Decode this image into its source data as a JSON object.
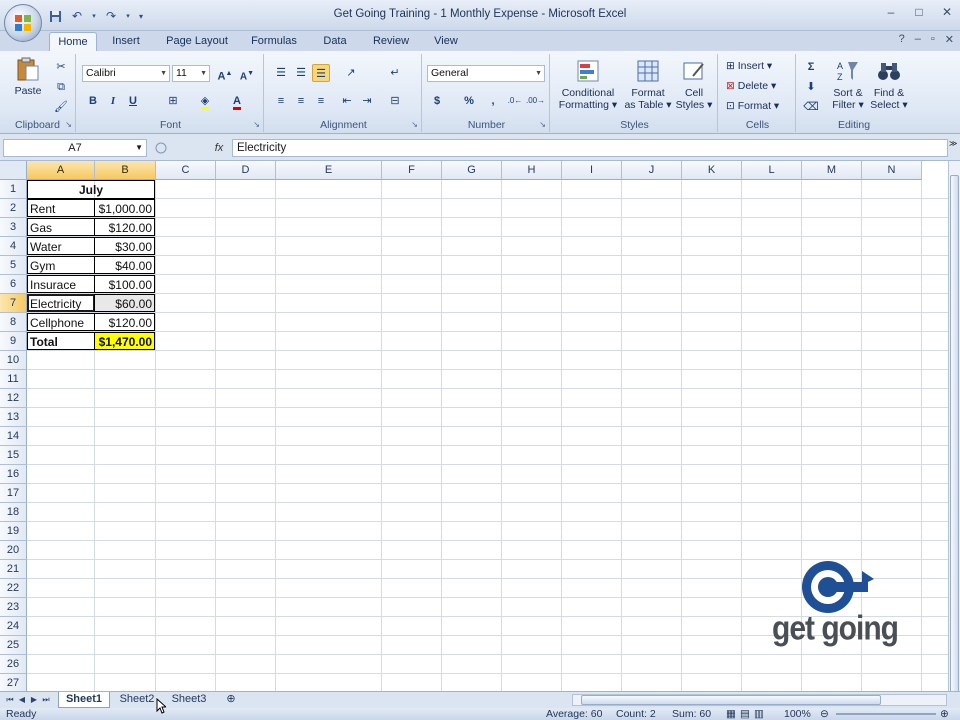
{
  "window": {
    "title": "Get Going Training - 1 Monthly Expense - Microsoft Excel",
    "controls": [
      "–",
      "□",
      "✕"
    ]
  },
  "qat": {
    "icons": [
      "save-icon",
      "undo-icon",
      "redo-icon",
      "customize-icon"
    ]
  },
  "tabs": [
    "Home",
    "Insert",
    "Page Layout",
    "Formulas",
    "Data",
    "Review",
    "View"
  ],
  "active_tab": "Home",
  "ribbon": {
    "clipboard": {
      "label": "Clipboard",
      "paste": "Paste"
    },
    "font": {
      "label": "Font",
      "name": "Calibri",
      "size": "11",
      "bold": "B",
      "italic": "I",
      "underline": "U"
    },
    "alignment": {
      "label": "Alignment"
    },
    "number": {
      "label": "Number",
      "format": "General",
      "currency": "$",
      "percent": "%",
      "comma": ","
    },
    "styles": {
      "label": "Styles",
      "conditional_1": "Conditional",
      "conditional_2": "Formatting",
      "format_table_1": "Format",
      "format_table_2": "as Table",
      "cell_styles_1": "Cell",
      "cell_styles_2": "Styles"
    },
    "cells": {
      "label": "Cells",
      "insert": "Insert",
      "delete": "Delete",
      "format": "Format"
    },
    "editing": {
      "label": "Editing",
      "sort_1": "Sort &",
      "sort_2": "Filter",
      "find_1": "Find &",
      "find_2": "Select"
    }
  },
  "formula_bar": {
    "name_box": "A7",
    "fx": "fx",
    "content": "Electricity"
  },
  "columns": [
    "A",
    "B",
    "C",
    "D",
    "E",
    "F",
    "G",
    "H",
    "I",
    "J",
    "K",
    "L",
    "M",
    "N"
  ],
  "rows": [
    "1",
    "2",
    "3",
    "4",
    "5",
    "6",
    "7",
    "8",
    "9",
    "10",
    "11",
    "12",
    "13",
    "14",
    "15",
    "16",
    "17",
    "18",
    "19",
    "20",
    "21",
    "22",
    "23",
    "24",
    "25",
    "26",
    "27"
  ],
  "sheet": {
    "header": "July",
    "items": [
      {
        "label": "Rent",
        "value": "$1,000.00"
      },
      {
        "label": "Gas",
        "value": "$120.00"
      },
      {
        "label": "Water",
        "value": "$30.00"
      },
      {
        "label": "Gym",
        "value": "$40.00"
      },
      {
        "label": "Insurace",
        "value": "$100.00"
      },
      {
        "label": "Electricity",
        "value": "$60.00"
      },
      {
        "label": "Cellphone",
        "value": "$120.00"
      }
    ],
    "total": {
      "label": "Total",
      "value": "$1,470.00"
    },
    "active_cell": "A7",
    "highlight_color": "#ffff00"
  },
  "sheet_tabs": [
    "Sheet1",
    "Sheet2",
    "Sheet3"
  ],
  "active_sheet": "Sheet1",
  "status": {
    "ready": "Ready",
    "average": "Average: 60",
    "count": "Count: 2",
    "sum": "Sum: 60",
    "zoom": "100%"
  },
  "watermark": {
    "text": "get going"
  }
}
